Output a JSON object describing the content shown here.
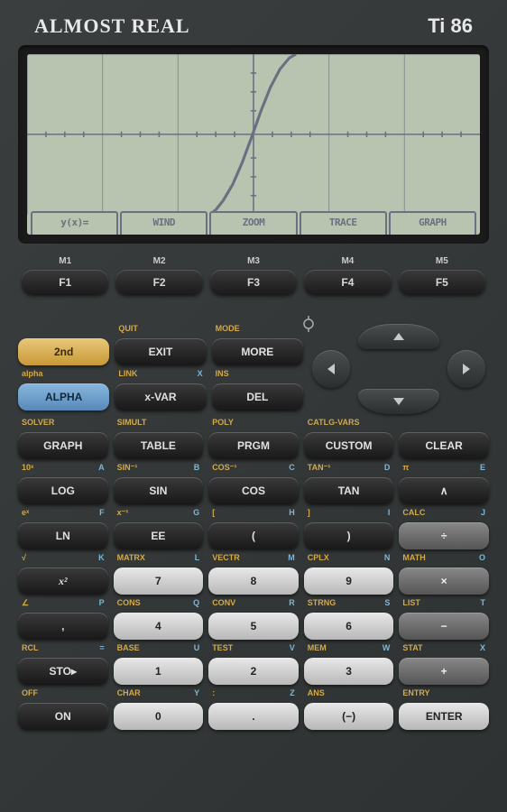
{
  "brand": "ALMOST REAL",
  "model": "Ti 86",
  "screen_menu": [
    "y(x)=",
    "WIND",
    "ZOOM",
    "TRACE",
    "GRAPH"
  ],
  "fkeys": [
    {
      "top": "M1",
      "label": "F1"
    },
    {
      "top": "M2",
      "label": "F2"
    },
    {
      "top": "M3",
      "label": "F3"
    },
    {
      "top": "M4",
      "label": "F4"
    },
    {
      "top": "M5",
      "label": "F5"
    }
  ],
  "r1": [
    {
      "ll": "",
      "lr": "",
      "label": "2nd",
      "style": "k-gold"
    },
    {
      "ll": "QUIT",
      "lr": "",
      "label": "EXIT",
      "style": "k-dark"
    },
    {
      "ll": "MODE",
      "lr": "",
      "label": "MORE",
      "style": "k-dark"
    }
  ],
  "r2": [
    {
      "ll": "alpha",
      "lr": "",
      "label": "ALPHA",
      "style": "k-blue"
    },
    {
      "ll": "LINK",
      "lr": "X",
      "label": "x-VAR",
      "style": "k-dark"
    },
    {
      "ll": "INS",
      "lr": "",
      "label": "DEL",
      "style": "k-dark"
    }
  ],
  "r3": [
    {
      "ll": "SOLVER",
      "lr": "",
      "label": "GRAPH",
      "style": "k-dark"
    },
    {
      "ll": "SIMULT",
      "lr": "",
      "label": "TABLE",
      "style": "k-dark"
    },
    {
      "ll": "POLY",
      "lr": "",
      "label": "PRGM",
      "style": "k-dark"
    },
    {
      "ll": "CATLG-VARS",
      "lr": "",
      "label": "CUSTOM",
      "style": "k-dark"
    },
    {
      "ll": "",
      "lr": "",
      "label": "CLEAR",
      "style": "k-dark"
    }
  ],
  "r4": [
    {
      "ll": "10ˣ",
      "lr": "A",
      "label": "LOG",
      "style": "k-dark"
    },
    {
      "ll": "SIN⁻¹",
      "lr": "B",
      "label": "SIN",
      "style": "k-dark"
    },
    {
      "ll": "COS⁻¹",
      "lr": "C",
      "label": "COS",
      "style": "k-dark"
    },
    {
      "ll": "TAN⁻¹",
      "lr": "D",
      "label": "TAN",
      "style": "k-dark"
    },
    {
      "ll": "π",
      "lr": "E",
      "label": "∧",
      "style": "k-dark"
    }
  ],
  "r5": [
    {
      "ll": "eˣ",
      "lr": "F",
      "label": "LN",
      "style": "k-dark"
    },
    {
      "ll": "x⁻¹",
      "lr": "G",
      "label": "EE",
      "style": "k-dark"
    },
    {
      "ll": "[",
      "lr": "H",
      "label": "(",
      "style": "k-dark"
    },
    {
      "ll": "]",
      "lr": "I",
      "label": ")",
      "style": "k-dark"
    },
    {
      "ll": "CALC",
      "lr": "J",
      "label": "÷",
      "style": "k-gray"
    }
  ],
  "r6": [
    {
      "ll": "√",
      "lr": "K",
      "label": "x²",
      "style": "k-dark",
      "italic": true
    },
    {
      "ll": "MATRX",
      "lr": "L",
      "label": "7",
      "style": "k-white"
    },
    {
      "ll": "VECTR",
      "lr": "M",
      "label": "8",
      "style": "k-white"
    },
    {
      "ll": "CPLX",
      "lr": "N",
      "label": "9",
      "style": "k-white"
    },
    {
      "ll": "MATH",
      "lr": "O",
      "label": "×",
      "style": "k-gray"
    }
  ],
  "r7": [
    {
      "ll": "∠",
      "lr": "P",
      "label": ",",
      "style": "k-dark"
    },
    {
      "ll": "CONS",
      "lr": "Q",
      "label": "4",
      "style": "k-white"
    },
    {
      "ll": "CONV",
      "lr": "R",
      "label": "5",
      "style": "k-white"
    },
    {
      "ll": "STRNG",
      "lr": "S",
      "label": "6",
      "style": "k-white"
    },
    {
      "ll": "LIST",
      "lr": "T",
      "label": "−",
      "style": "k-gray"
    }
  ],
  "r8": [
    {
      "ll": "RCL",
      "lr": "=",
      "label": "STO▸",
      "style": "k-dark"
    },
    {
      "ll": "BASE",
      "lr": "U",
      "label": "1",
      "style": "k-white"
    },
    {
      "ll": "TEST",
      "lr": "V",
      "label": "2",
      "style": "k-white"
    },
    {
      "ll": "MEM",
      "lr": "W",
      "label": "3",
      "style": "k-white"
    },
    {
      "ll": "STAT",
      "lr": "X",
      "label": "+",
      "style": "k-gray"
    }
  ],
  "r9": [
    {
      "ll": "OFF",
      "lr": "",
      "label": "ON",
      "style": "k-dark"
    },
    {
      "ll": "CHAR",
      "lr": "Y",
      "label": "0",
      "style": "k-white"
    },
    {
      "ll": ":",
      "lr": "Z",
      "label": ".",
      "style": "k-white"
    },
    {
      "ll": "ANS",
      "lr": "",
      "label": "(−)",
      "style": "k-white"
    },
    {
      "ll": "ENTRY",
      "lr": "",
      "label": "ENTER",
      "style": "k-white"
    }
  ]
}
